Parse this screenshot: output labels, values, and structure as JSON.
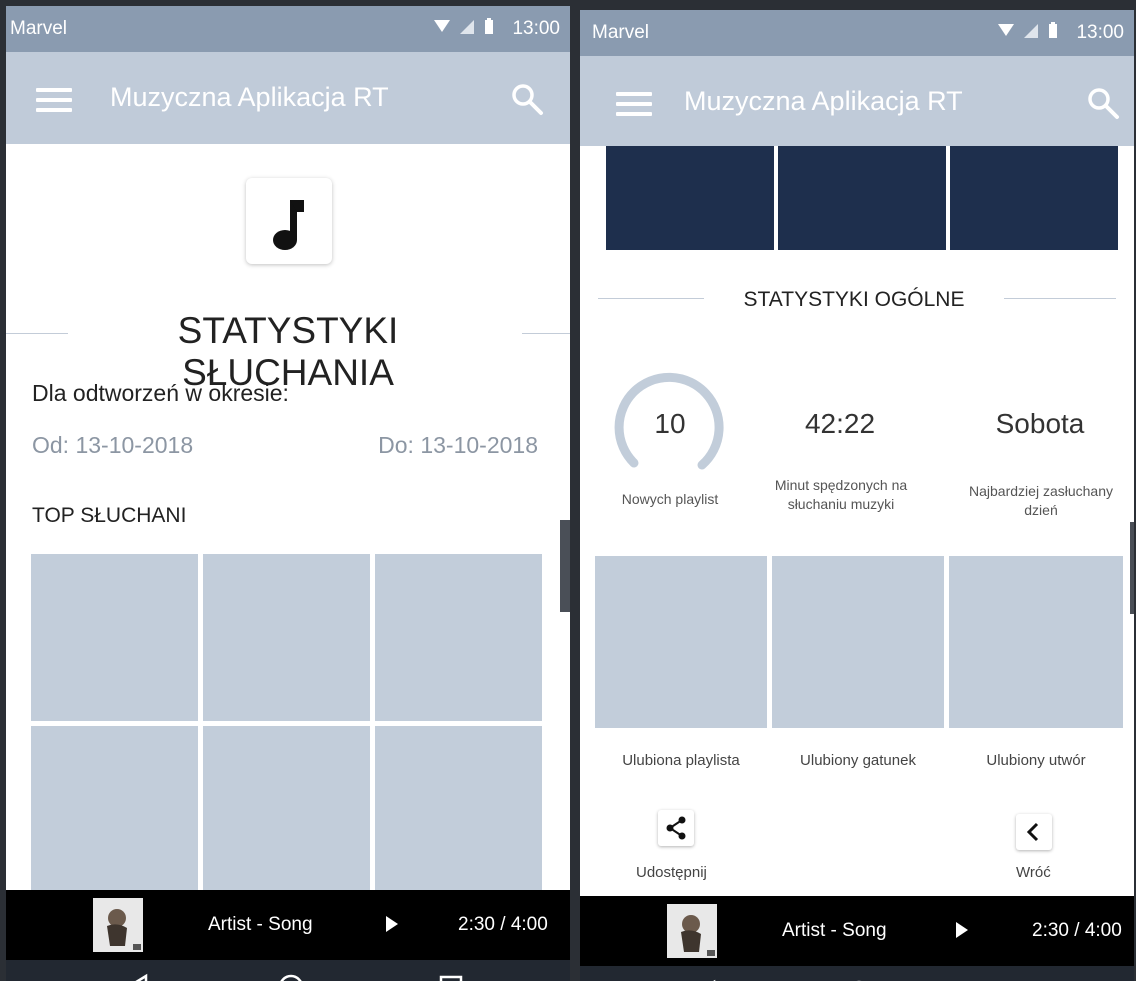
{
  "status_bar": {
    "carrier": "Marvel",
    "time": "13:00"
  },
  "app_bar": {
    "title": "Muzyczna Aplikacja RT"
  },
  "left_screen": {
    "section_title": "STATYSTYKI SŁUCHANIA",
    "period_label": "Dla odtworzeń w okresie:",
    "date_from": "Od: 13-10-2018",
    "date_to": "Do: 13-10-2018",
    "top_heading": "TOP SŁUCHANI"
  },
  "right_screen": {
    "section_title": "STATYSTYKI OGÓLNE",
    "stats": [
      {
        "value": "10",
        "caption": "Nowych playlist"
      },
      {
        "value": "42:22",
        "caption": "Minut spędzonych na słuchaniu muzyki"
      },
      {
        "value": "Sobota",
        "caption": "Najbardziej zasłuchany dzień"
      }
    ],
    "favorites": [
      {
        "caption": "Ulubiona playlista"
      },
      {
        "caption": "Ulubiony gatunek"
      },
      {
        "caption": "Ulubiony utwór"
      }
    ],
    "actions": {
      "share_label": "Udostępnij",
      "back_label": "Wróć"
    }
  },
  "player": {
    "song": "Artist - Song",
    "time": "2:30 / 4:00"
  },
  "colors": {
    "status_bar": "#8a9bb0",
    "app_bar": "#c0cbd9",
    "tile_light": "#c2cdda",
    "tile_dark": "#1e2f4d",
    "date_text": "#8c96a3"
  }
}
